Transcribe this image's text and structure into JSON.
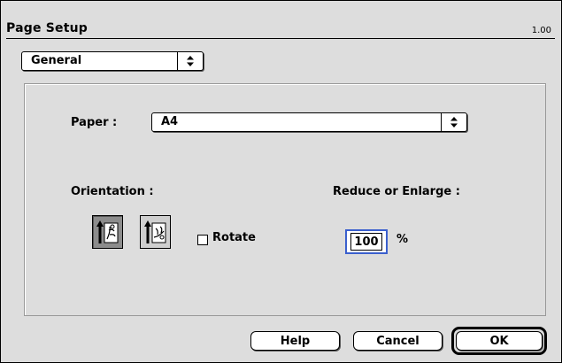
{
  "dialog": {
    "title": "Page Setup",
    "version": "1.00"
  },
  "section_popup": {
    "value": "General",
    "icon": "updown-arrows-icon"
  },
  "paper": {
    "label": "Paper :",
    "value": "A4",
    "icon": "updown-arrows-icon"
  },
  "orientation": {
    "label": "Orientation :",
    "options": [
      {
        "name": "portrait",
        "selected": true
      },
      {
        "name": "landscape",
        "selected": false
      }
    ],
    "rotate_label": "Rotate",
    "rotate_checked": false
  },
  "scale": {
    "label": "Reduce or Enlarge :",
    "value": "100",
    "unit": "%"
  },
  "buttons": {
    "help": "Help",
    "cancel": "Cancel",
    "ok": "OK"
  },
  "colors": {
    "background": "#dddddd",
    "focus_ring": "#3a5fcd"
  }
}
